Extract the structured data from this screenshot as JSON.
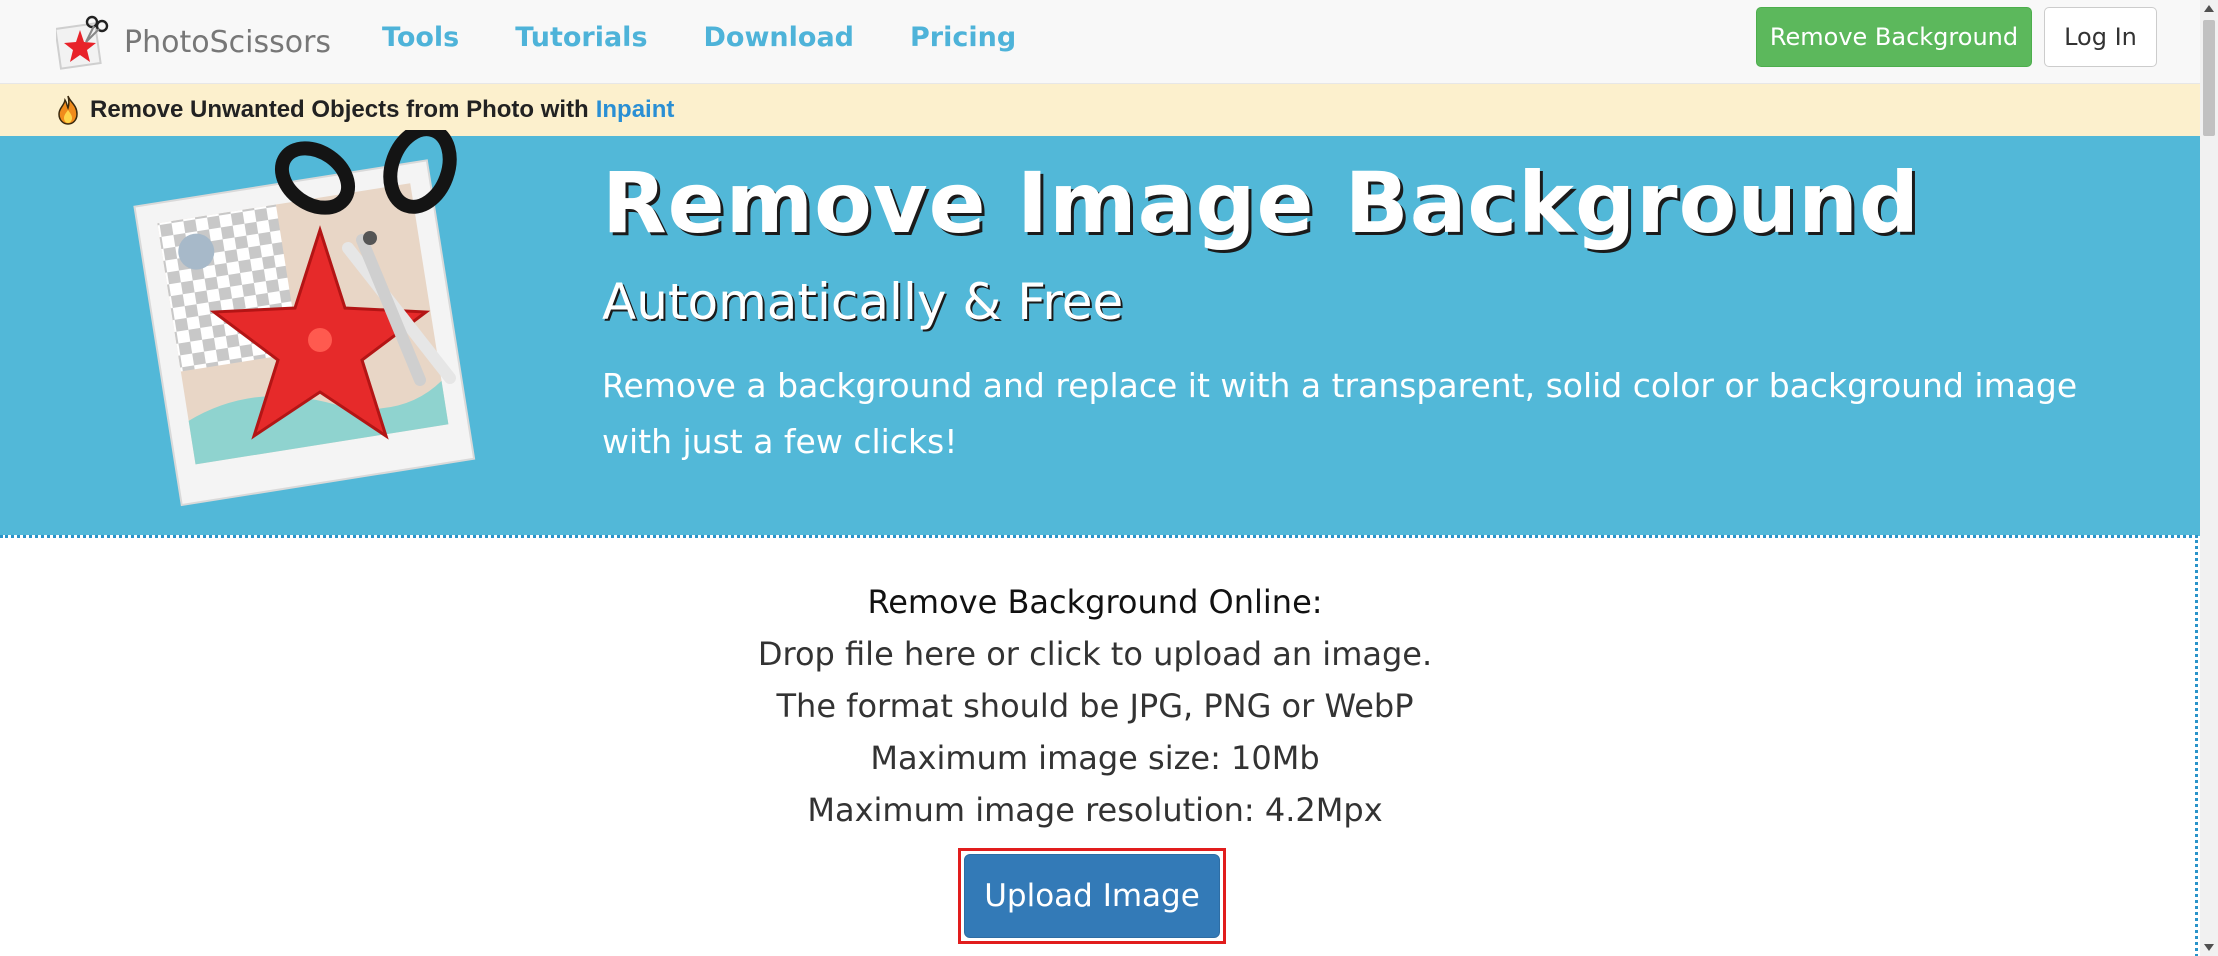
{
  "navbar": {
    "brand_name": "PhotoScissors",
    "links": [
      {
        "label": "Tools"
      },
      {
        "label": "Tutorials"
      },
      {
        "label": "Download"
      },
      {
        "label": "Pricing"
      }
    ],
    "remove_bg_label": "Remove Background",
    "login_label": "Log In",
    "link_color": "#4eb3d9"
  },
  "promo": {
    "icon": "fire-icon",
    "text": "Remove Unwanted Objects from Photo with",
    "link_label": "Inpaint",
    "background": "#fcf0cd"
  },
  "hero": {
    "title": "Remove Image Background",
    "subtitle": "Automatically & Free",
    "description_line1": "Remove a background and replace it with a transparent, solid color or background image",
    "description_line2": "with just a few clicks!",
    "background": "#52b8d8",
    "illustration_icon": "starfish-scissors-icon"
  },
  "upload": {
    "heading": "Remove Background Online:",
    "lines": [
      "Drop file here or click to upload an image.",
      "The format should be JPG, PNG or WebP",
      "Maximum image size: 10Mb",
      "Maximum image resolution: 4.2Mpx"
    ],
    "button_label": "Upload Image",
    "button_color": "#337ab7",
    "highlight_color": "#e11d1d"
  },
  "colors": {
    "success": "#5cb85c",
    "primary": "#337ab7"
  }
}
